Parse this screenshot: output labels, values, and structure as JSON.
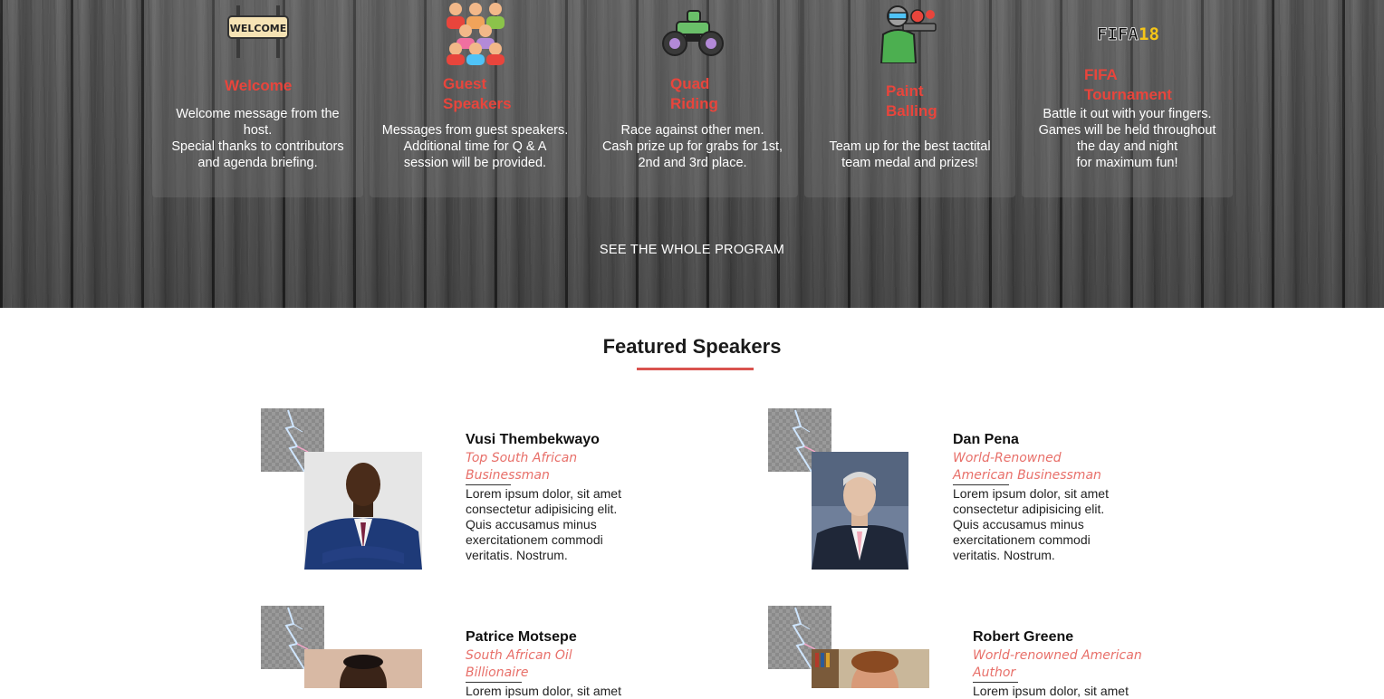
{
  "program": {
    "cards": [
      {
        "title_lines": [
          "Welcome"
        ],
        "desc": "Welcome message from the\nhost.\nSpecial thanks to contributors\nand agenda briefing.",
        "icon": "welcome-sign-icon"
      },
      {
        "title_lines": [
          "Guest",
          "Speakers"
        ],
        "desc": "Messages from guest speakers.\nAdditional time for Q & A\nsession will be provided.",
        "icon": "audience-icon"
      },
      {
        "title_lines": [
          "Quad",
          "Riding"
        ],
        "desc": "Race against other men.\nCash prize up for grabs for 1st,\n2nd and 3rd place.",
        "icon": "quad-bike-icon"
      },
      {
        "title_lines": [
          "Paint",
          "Balling"
        ],
        "desc": "Team up for the best tactital\nteam medal and prizes!",
        "icon": "paintball-player-icon"
      },
      {
        "title_lines": [
          "FIFA",
          "Tournament"
        ],
        "desc": "Battle it out with your fingers.\nGames will be held throughout\nthe day and night\nfor maximum fun!",
        "icon": "fifa-logo-icon",
        "logo_text": "FIFA18"
      }
    ],
    "see_all_label": "SEE THE WHOLE PROGRAM"
  },
  "speakers_section": {
    "title": "Featured Speakers",
    "speakers": [
      {
        "name": "Vusi Thembekwayo",
        "role": "Top South African Businessman",
        "bio": "Lorem ipsum dolor, sit amet\nconsectetur adipisicing elit.\nQuis accusamus minus\nexercitationem commodi\nveritatis. Nostrum."
      },
      {
        "name": "Dan Pena",
        "role": "World-Renowned American Businessman",
        "bio": "Lorem ipsum dolor, sit amet\nconsectetur adipisicing elit.\nQuis accusamus minus\nexercitationem commodi\nveritatis. Nostrum."
      },
      {
        "name": "Patrice Motsepe",
        "role": "South African Oil Billionaire",
        "bio": "Lorem ipsum dolor, sit amet"
      },
      {
        "name": "Robert Greene",
        "role": "World-renowned American Author",
        "bio": "Lorem ipsum dolor, sit amet"
      }
    ]
  },
  "colors": {
    "accent": "#e8453c",
    "underline": "#d9534f",
    "role_text": "#e8706a"
  }
}
